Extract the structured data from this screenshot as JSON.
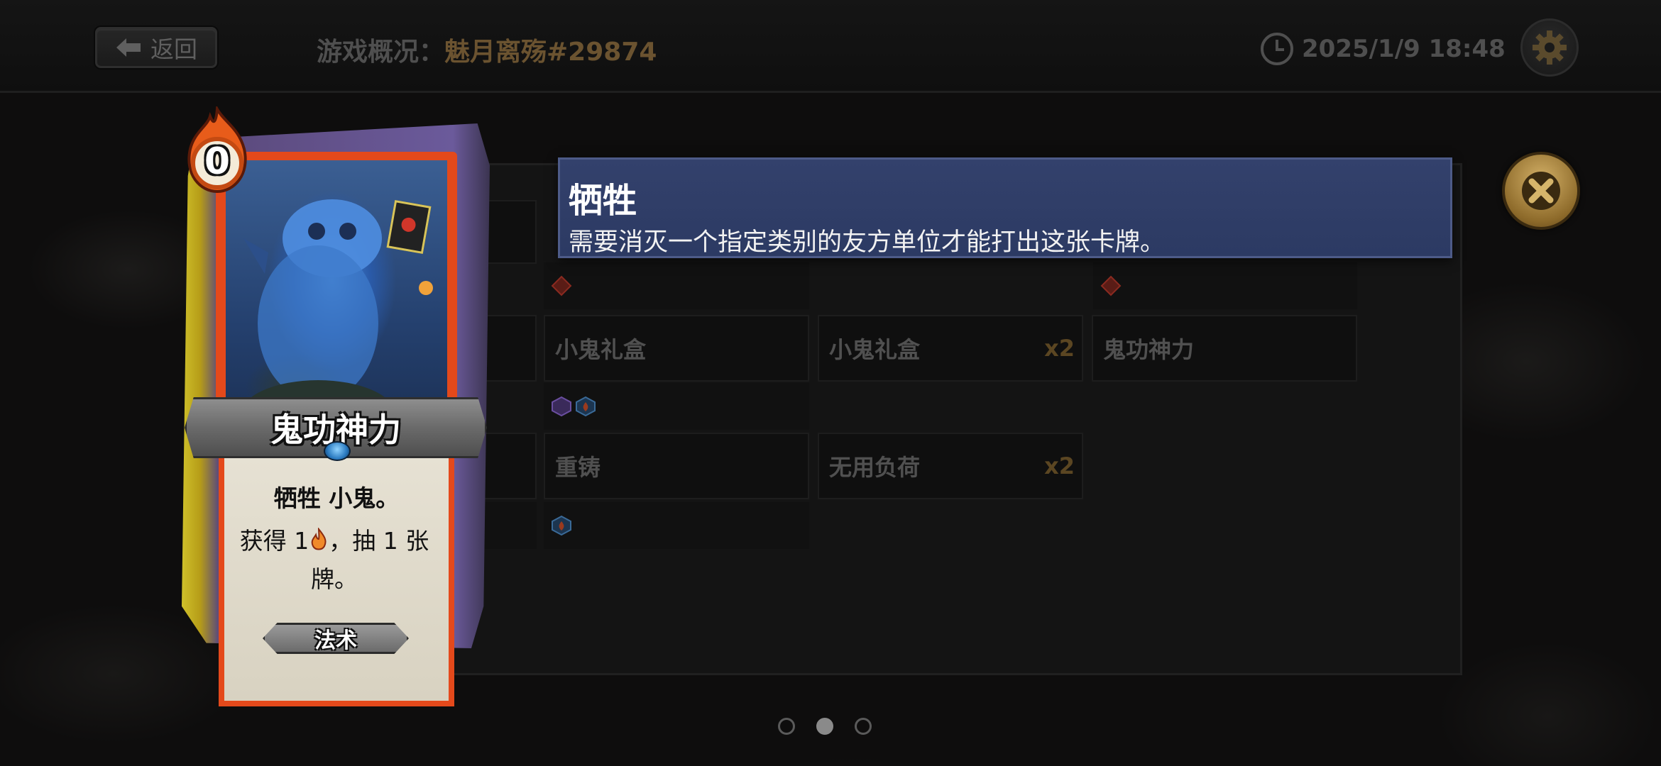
{
  "header": {
    "back_label": "返回",
    "title_label": "游戏概况：",
    "player_name": "魅月离殇#29874",
    "timestamp": "2025/1/9 18:48",
    "settings_icon": "gear-icon",
    "clock_icon": "clock-icon"
  },
  "tooltip": {
    "title": "牺牲",
    "text": "需要消灭一个指定类别的友方单位才能打出这张卡牌。"
  },
  "card": {
    "cost": "0",
    "name": "鬼功神力",
    "keyword_line": "牺牲 小鬼。",
    "effect_part1": "获得 1",
    "effect_part2": "，抽 1 张牌。",
    "type": "法术"
  },
  "grid": {
    "cards": [
      {
        "name": "小鬼礼盒",
        "count": ""
      },
      {
        "name": "小鬼礼盒",
        "count": "x2"
      },
      {
        "name": "鬼功神力",
        "count": ""
      },
      {
        "name": "重铸",
        "count": ""
      },
      {
        "name": "无用负荷",
        "count": "x2"
      }
    ]
  },
  "pagination": {
    "total": 3,
    "current": 2
  },
  "colors": {
    "accent_gold": "#6b5330",
    "tooltip_bg": "#33416c",
    "close_gold": "#c9a55c"
  }
}
